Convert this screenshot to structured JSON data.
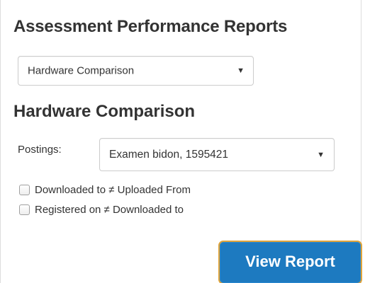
{
  "page": {
    "title": "Assessment Performance Reports"
  },
  "report_select": {
    "selected": "Hardware Comparison",
    "caret_icon": "triangle-down-icon"
  },
  "section": {
    "title": "Hardware Comparison"
  },
  "postings": {
    "label": "Postings:",
    "selected": "Examen bidon, 1595421",
    "caret_icon": "triangle-down-icon"
  },
  "filters": [
    {
      "label": "Downloaded to ≠ Uploaded From",
      "checked": false
    },
    {
      "label": "Registered on ≠ Downloaded to",
      "checked": false
    }
  ],
  "actions": {
    "view_report_label": "View Report",
    "accent_color": "#1d7ac0",
    "focus_color": "#e0a43a"
  }
}
